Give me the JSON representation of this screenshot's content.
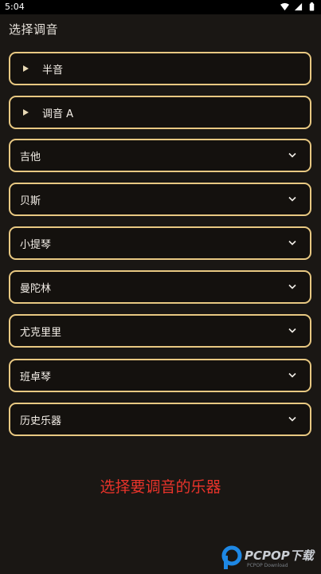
{
  "statusbar": {
    "time": "5:04"
  },
  "page": {
    "title": "选择调音"
  },
  "modes": [
    {
      "label": "半音"
    },
    {
      "label": "调音 A"
    }
  ],
  "instruments": [
    {
      "label": "吉他"
    },
    {
      "label": "贝斯"
    },
    {
      "label": "小提琴"
    },
    {
      "label": "曼陀林"
    },
    {
      "label": "尤克里里"
    },
    {
      "label": "班卓琴"
    },
    {
      "label": "历史乐器"
    }
  ],
  "hint": "选择要调音的乐器",
  "watermark": {
    "brand": "PCPOP下载",
    "sub": "PCPOP Download"
  },
  "colors": {
    "accent": "#e8c882",
    "background": "#1a1714",
    "hint": "#e8332a"
  }
}
